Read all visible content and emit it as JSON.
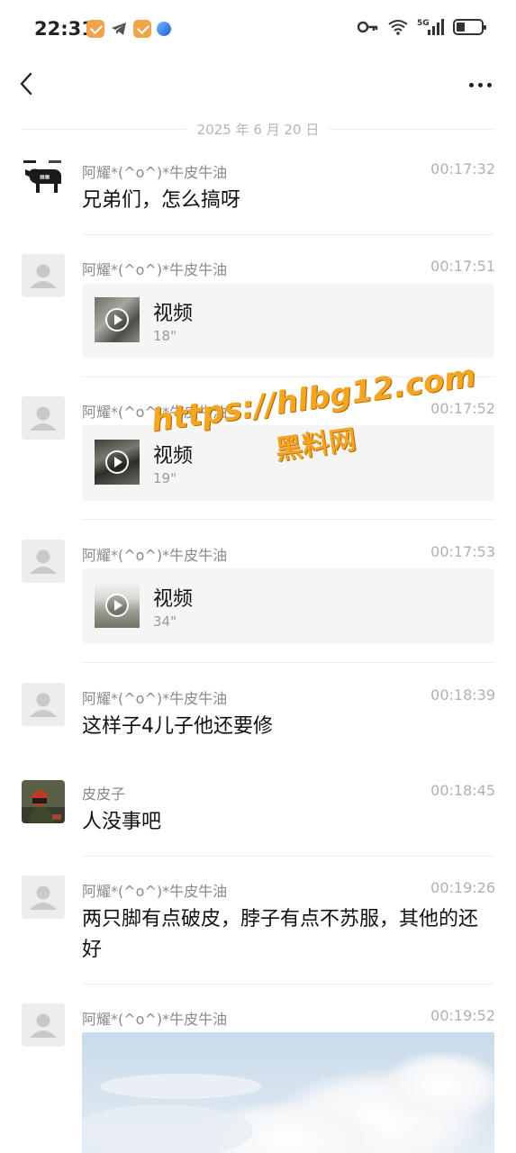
{
  "status_bar": {
    "time": "22:31",
    "network": "5G"
  },
  "date_separator": "2025 年 6 月 20 日",
  "messages": [
    {
      "sender": "阿耀*(^o^)*牛皮牛油",
      "time": "00:17:32",
      "text": "兄弟们，怎么搞呀"
    },
    {
      "sender": "阿耀*(^o^)*牛皮牛油",
      "time": "00:17:51",
      "video_label": "视频",
      "duration": "18\""
    },
    {
      "sender": "阿耀*(^o^)*牛皮牛油",
      "time": "00:17:52",
      "video_label": "视频",
      "duration": "19\""
    },
    {
      "sender": "阿耀*(^o^)*牛皮牛油",
      "time": "00:17:53",
      "video_label": "视频",
      "duration": "34\""
    },
    {
      "sender": "阿耀*(^o^)*牛皮牛油",
      "time": "00:18:39",
      "text": "这样子4儿子他还要修"
    },
    {
      "sender": "皮皮子",
      "time": "00:18:45",
      "text": "人没事吧"
    },
    {
      "sender": "阿耀*(^o^)*牛皮牛油",
      "time": "00:19:26",
      "text": "两只脚有点破皮，脖子有点不苏服，其他的还好"
    },
    {
      "sender": "阿耀*(^o^)*牛皮牛油",
      "time": "00:19:52"
    }
  ],
  "watermark": {
    "url": "https://hlbg12.com",
    "name": "黑料网"
  },
  "colors": {
    "watermark": "#f4a524",
    "bubble_bg": "#f5f5f5"
  }
}
